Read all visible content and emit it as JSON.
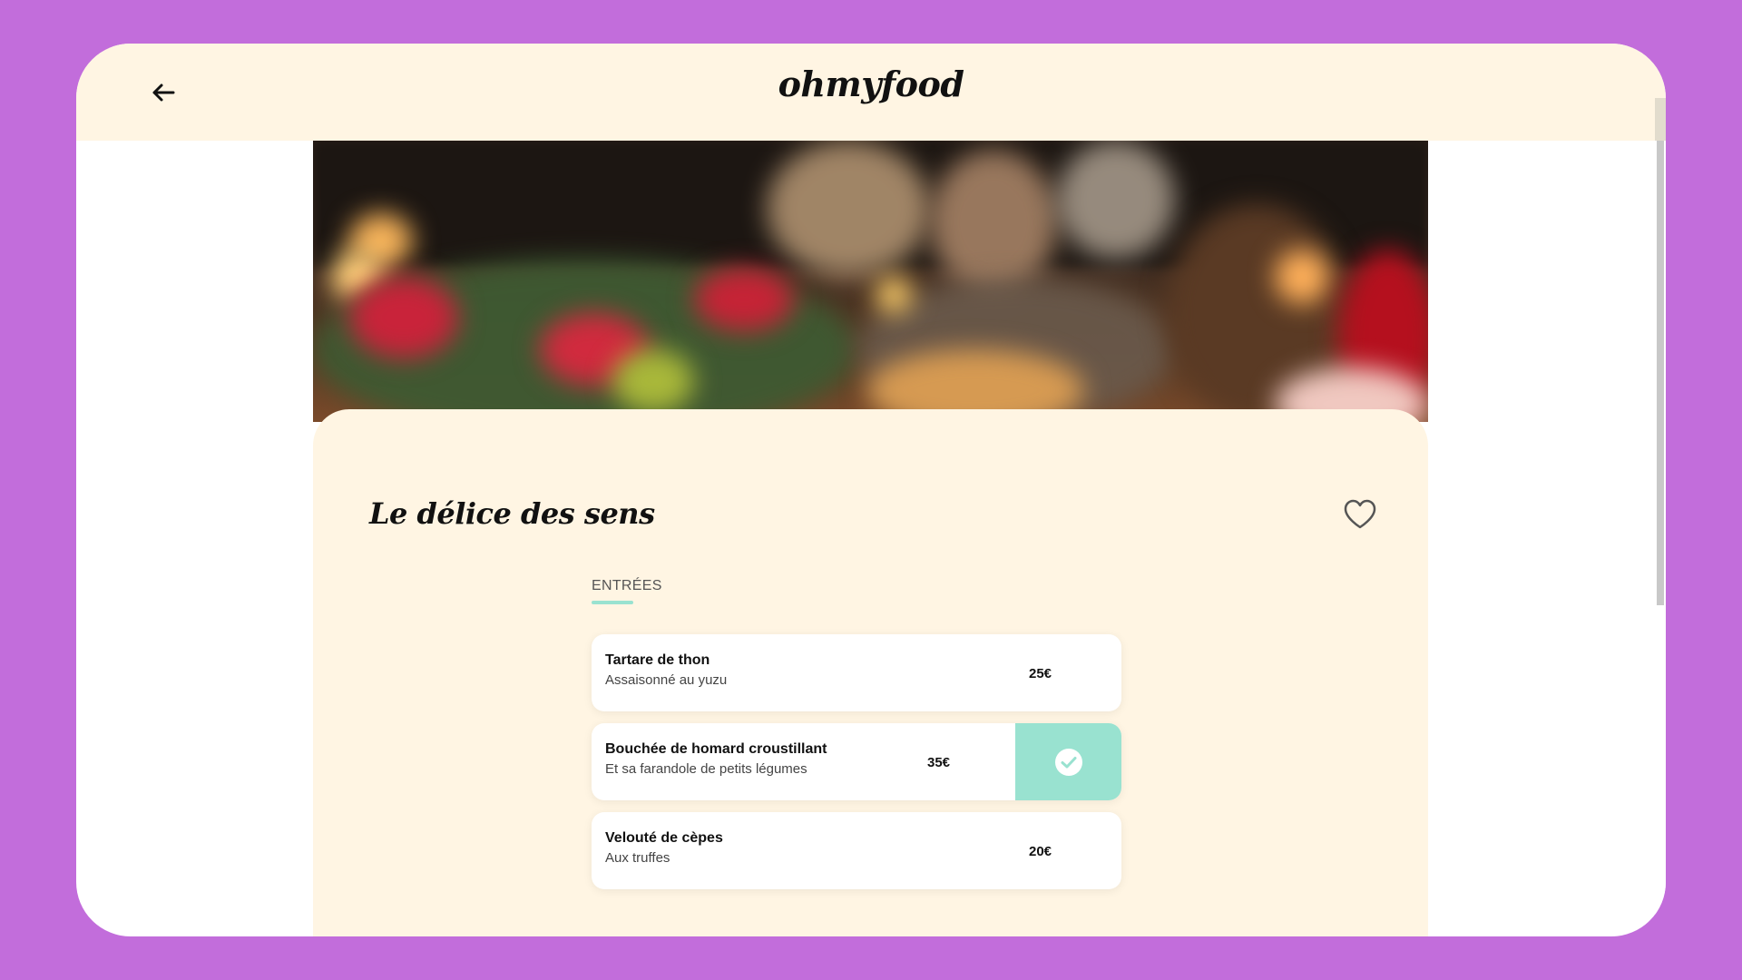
{
  "header": {
    "logo": "ohmyfood",
    "back_icon": "arrow-left-icon"
  },
  "restaurant": {
    "name": "Le délice des sens",
    "favorite_icon": "heart-outline-icon"
  },
  "menu": {
    "section_title": "ENTRÉES",
    "accent_color": "#99e2d0",
    "items": [
      {
        "name": "Tartare de thon",
        "description": "Assaisonné au yuzu",
        "price": "25€",
        "selected": false
      },
      {
        "name": "Bouchée de homard croustillant",
        "description": "Et sa farandole de petits légumes",
        "price": "35€",
        "selected": true
      },
      {
        "name": "Velouté de cèpes",
        "description": "Aux truffes",
        "price": "20€",
        "selected": false
      }
    ]
  },
  "colors": {
    "page_background": "#c26ddb",
    "header_background": "#fff5e3",
    "content_background": "#fff5e3"
  }
}
